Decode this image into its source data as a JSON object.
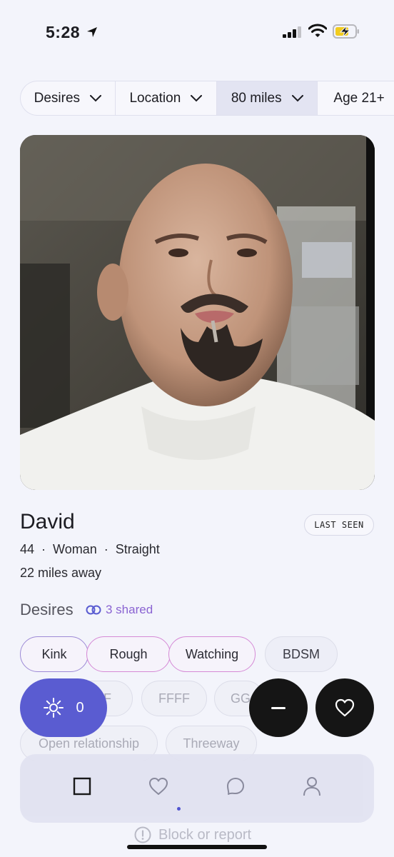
{
  "status": {
    "time": "5:28"
  },
  "filters": [
    {
      "label": "Desires"
    },
    {
      "label": "Location"
    },
    {
      "label": "80 miles"
    },
    {
      "label": "Age 21+"
    }
  ],
  "profile": {
    "name": "David",
    "last_seen": "LAST SEEN",
    "age": "44",
    "gender": "Woman",
    "orientation": "Straight",
    "distance": "22 miles away"
  },
  "desires": {
    "title": "Desires",
    "shared_label": "3 shared",
    "tags": [
      "Kink",
      "Rough",
      "Watching",
      "BDSM",
      "FF",
      "FFFF",
      "GG",
      "Open relationship",
      "Threeway"
    ]
  },
  "actions": {
    "likes_count": "0"
  },
  "tab_bar": {
    "items": [
      "square-icon",
      "heart-icon",
      "chat-icon",
      "profile-icon"
    ],
    "active_index": 1
  },
  "footer": {
    "block_report": "Block or report"
  },
  "colors": {
    "accent": "#5a5cd1",
    "shared": "#8a63d2",
    "background": "#f3f4fb"
  }
}
